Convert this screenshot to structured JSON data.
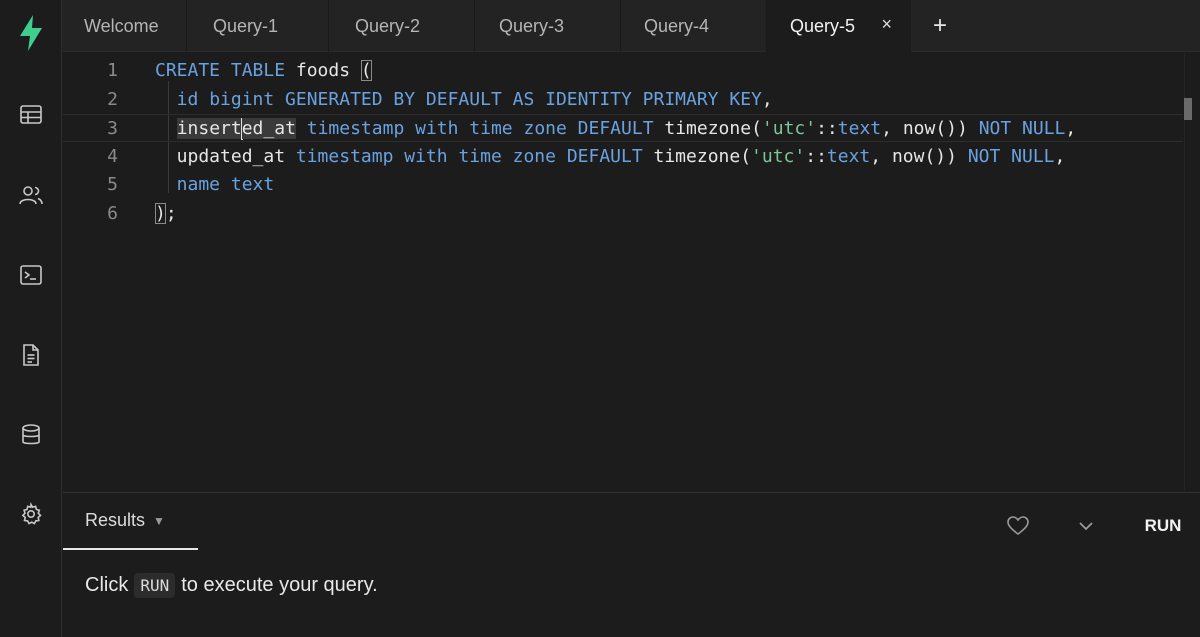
{
  "app": {
    "accent": "#3ecf8e"
  },
  "sidebar": {
    "items": [
      {
        "icon": "table-icon"
      },
      {
        "icon": "users-icon"
      },
      {
        "icon": "terminal-icon"
      },
      {
        "icon": "document-icon"
      },
      {
        "icon": "database-icon"
      },
      {
        "icon": "gear-icon"
      }
    ]
  },
  "tabs": [
    {
      "label": "Welcome"
    },
    {
      "label": "Query-1"
    },
    {
      "label": "Query-2"
    },
    {
      "label": "Query-3"
    },
    {
      "label": "Query-4"
    },
    {
      "label": "Query-5",
      "active": true,
      "close": "×"
    }
  ],
  "new_tab_label": "+",
  "editor": {
    "line_numbers": [
      "1",
      "2",
      "3",
      "4",
      "5",
      "6"
    ],
    "lines": [
      [
        {
          "t": "CREATE TABLE",
          "c": "kw"
        },
        {
          "t": " foods ",
          "c": "plain"
        },
        {
          "t": "(",
          "c": "plain",
          "box": true
        }
      ],
      [
        {
          "t": "  id ",
          "c": "kw"
        },
        {
          "t": "bigint GENERATED BY DEFAULT AS IDENTITY PRIMARY KEY",
          "c": "kw"
        },
        {
          "t": ",",
          "c": "plain"
        }
      ],
      [
        {
          "t": "  ",
          "c": "plain"
        },
        {
          "t": "insert",
          "c": "plain",
          "hl": true
        },
        {
          "t": "|caret|",
          "c": "caret"
        },
        {
          "t": "ed_at",
          "c": "plain",
          "hl": true
        },
        {
          "t": " timestamp with time zone ",
          "c": "kw"
        },
        {
          "t": "DEFAULT",
          "c": "kw"
        },
        {
          "t": " timezone(",
          "c": "plain"
        },
        {
          "t": "'utc'",
          "c": "str"
        },
        {
          "t": "::",
          "c": "plain"
        },
        {
          "t": "text",
          "c": "kw"
        },
        {
          "t": ", now()) ",
          "c": "plain"
        },
        {
          "t": "NOT NULL",
          "c": "kw"
        },
        {
          "t": ",",
          "c": "plain"
        }
      ],
      [
        {
          "t": "  updated_at",
          "c": "plain"
        },
        {
          "t": " timestamp with time zone ",
          "c": "kw"
        },
        {
          "t": "DEFAULT",
          "c": "kw"
        },
        {
          "t": " timezone(",
          "c": "plain"
        },
        {
          "t": "'utc'",
          "c": "str"
        },
        {
          "t": "::",
          "c": "plain"
        },
        {
          "t": "text",
          "c": "kw"
        },
        {
          "t": ", now()) ",
          "c": "plain"
        },
        {
          "t": "NOT NULL",
          "c": "kw"
        },
        {
          "t": ",",
          "c": "plain"
        }
      ],
      [
        {
          "t": "  name ",
          "c": "kw"
        },
        {
          "t": "text",
          "c": "kw"
        }
      ],
      [
        {
          "t": ")",
          "c": "plain",
          "box": true
        },
        {
          "t": ";",
          "c": "plain"
        }
      ]
    ]
  },
  "results": {
    "tab_label": "Results",
    "tab_caret": "▼",
    "run_label": "RUN",
    "hint_before": "Click",
    "hint_kbd": "RUN",
    "hint_after": "to execute your query."
  }
}
